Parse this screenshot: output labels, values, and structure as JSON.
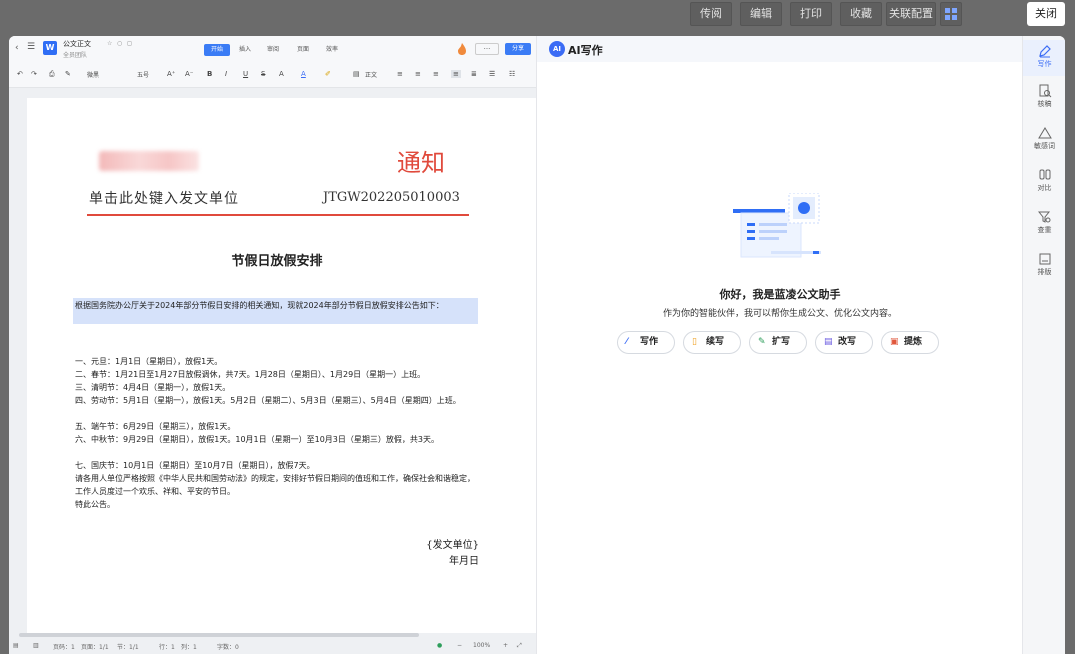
{
  "topbar": {
    "buttons": [
      "传阅",
      "编辑",
      "打印",
      "收藏",
      "关联配置"
    ],
    "close_label": "关闭"
  },
  "editor": {
    "doc_name": "公文正文",
    "team": "全员团队",
    "tabs": [
      "开始",
      "插入",
      "审阅",
      "页面",
      "效率"
    ],
    "share_label": "分享",
    "more_label": "···",
    "toolbar": {
      "font": "微黑",
      "size": "五号",
      "style": "正文"
    },
    "doc": {
      "heading_red": "通知",
      "unit_placeholder": "单击此处键入发文单位",
      "doc_number": "JTGW202205010003",
      "title": "节假日放假安排",
      "intro": "根据国务院办公厅关于2024年部分节假日安排的相关通知，现就2024年部分节假日放假安排公告如下：",
      "items": [
        "一、元旦：1月1日（星期日），放假1天。",
        "二、春节：1月21日至1月27日放假调休，共7天。1月28日（星期日）、1月29日（星期一）上班。",
        "三、清明节：4月4日（星期一），放假1天。",
        "四、劳动节：5月1日（星期一），放假1天。5月2日（星期二）、5月3日（星期三）、5月4日（星期四）上班。",
        "五、端午节：6月29日（星期三），放假1天。",
        "六、中秋节：9月29日（星期日），放假1天。10月1日（星期一）至10月3日（星期三）放假，共3天。",
        "七、国庆节：10月1日（星期日）至10月7日（星期日），放假7天。",
        "请各用人单位严格按照《中华人民共和国劳动法》的规定，安排好节假日期间的值班和工作，确保社会和谐稳定，工作人员度过一个欢乐、祥和、平安的节日。",
        "特此公告。"
      ],
      "signoff_unit": "{发文单位}",
      "signoff_date": "年月日"
    },
    "status": {
      "page_code": "页码：1",
      "pages": "页面：1/1",
      "section": "节：1/1",
      "row": "行：1",
      "col": "列：1",
      "words": "字数：0",
      "zoom": "100%"
    }
  },
  "ai": {
    "title": "AI写作",
    "logo": "AI",
    "greeting": "你好，我是蓝凌公文助手",
    "subtitle": "作为你的智能伙伴，我可以帮你生成公文、优化公文内容。",
    "actions": [
      "写作",
      "续写",
      "扩写",
      "改写",
      "提炼"
    ]
  },
  "rail": {
    "items": [
      "写作",
      "核稿",
      "敏感词",
      "对比",
      "查重",
      "排版"
    ]
  }
}
